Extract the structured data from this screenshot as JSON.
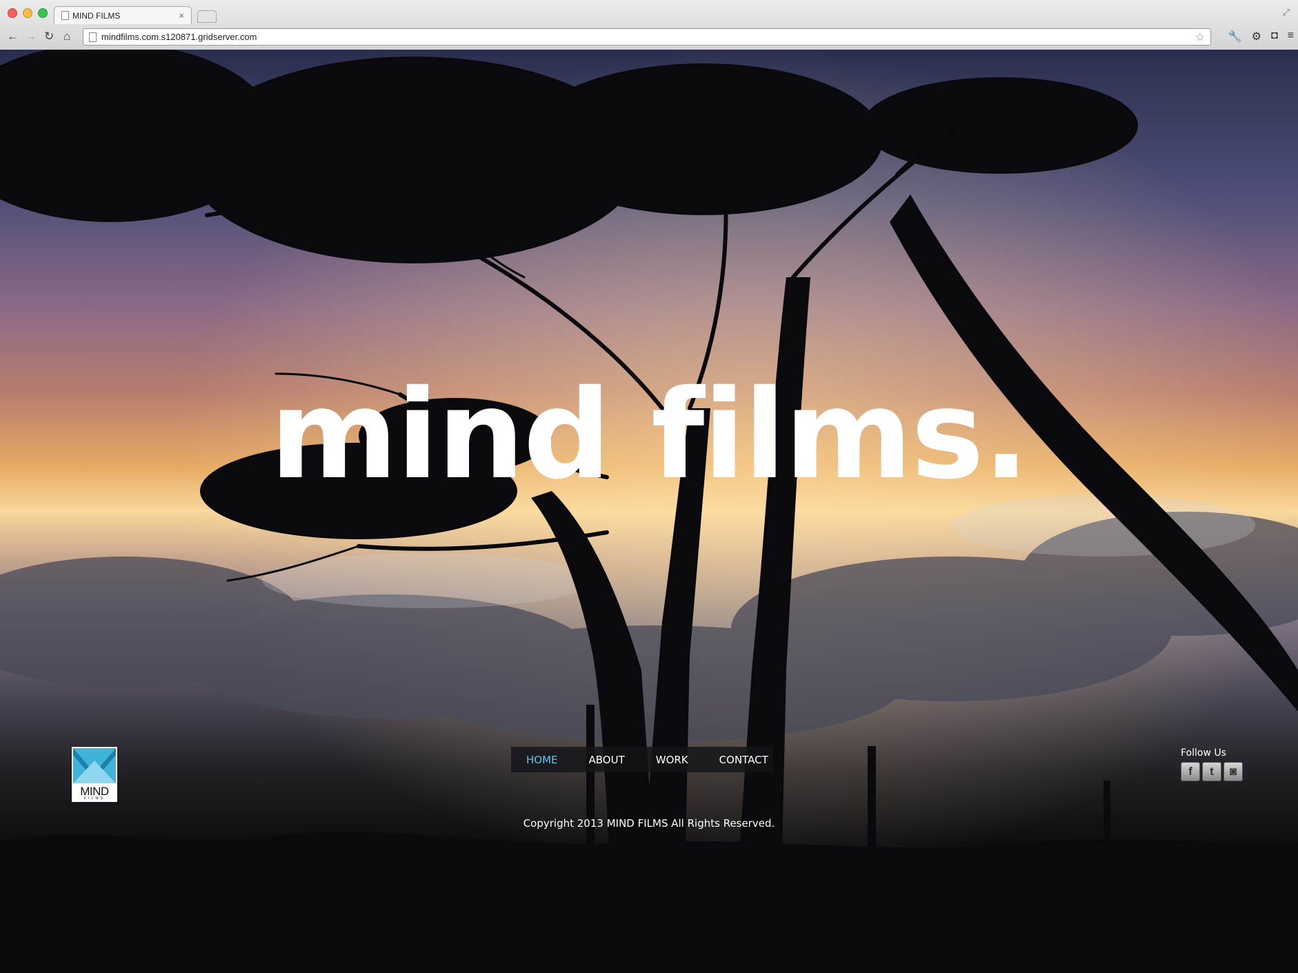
{
  "browser": {
    "tab_title": "MIND FILMS",
    "url": "mindfilms.com.s120871.gridserver.com"
  },
  "site": {
    "wordmark": "mind films.",
    "logo": {
      "text": "MIND",
      "subtext": "FILMS"
    },
    "nav": [
      {
        "label": "HOME",
        "active": true
      },
      {
        "label": "ABOUT",
        "active": false
      },
      {
        "label": "WORK",
        "active": false
      },
      {
        "label": "CONTACT",
        "active": false
      }
    ],
    "copyright": "Copyright 2013 MIND FILMS All Rights Reserved.",
    "follow_title": "Follow Us",
    "social": [
      {
        "icon": "facebook-icon",
        "glyph": "f"
      },
      {
        "icon": "twitter-icon",
        "glyph": "t"
      },
      {
        "icon": "instagram-icon",
        "glyph": "◙"
      }
    ]
  },
  "colors": {
    "nav_active": "#5fc7ee",
    "logo_accent": "#3fb3d9"
  }
}
